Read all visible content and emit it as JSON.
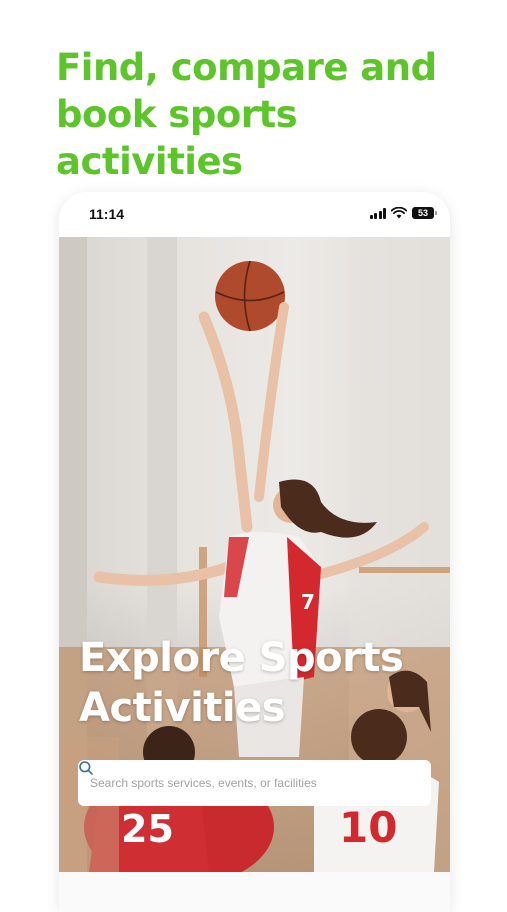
{
  "headline": {
    "line1": "Find, compare and",
    "line2": "book sports activities"
  },
  "status_bar": {
    "time": "11:14",
    "battery": "53",
    "icons": [
      "signal-icon",
      "wifi-icon",
      "battery-icon"
    ]
  },
  "hero": {
    "title_line1": "Explore Sports",
    "title_line2": "Activities",
    "jersey_numbers": [
      "25",
      "10",
      "7"
    ]
  },
  "search": {
    "placeholder": "Search sports services, events, or facilities",
    "icon": "search-icon"
  },
  "colors": {
    "accent": "#5cc52a",
    "ball": "#b04a2c",
    "jersey_red": "#d4282f"
  }
}
